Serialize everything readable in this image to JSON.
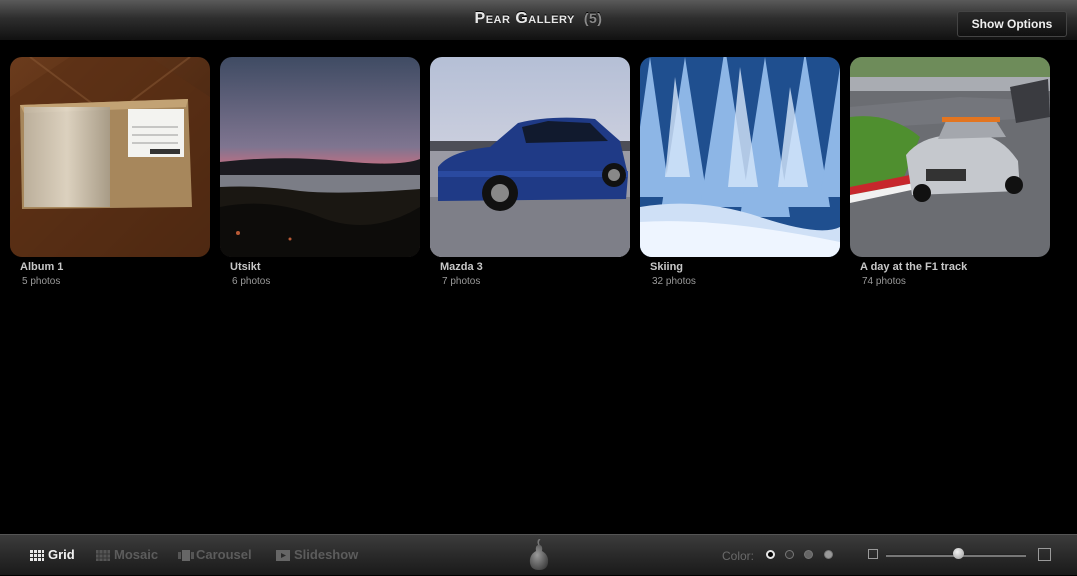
{
  "header": {
    "title": "Pear Gallery",
    "count": "(5)",
    "show_options_label": "Show Options"
  },
  "albums": [
    {
      "name": "Album 1",
      "count": "5 photos",
      "thumb": "cardboard-box-photo"
    },
    {
      "name": "Utsikt",
      "count": "6 photos",
      "thumb": "sunset-lake-photo"
    },
    {
      "name": "Mazda 3",
      "count": "7 photos",
      "thumb": "blue-car-photo"
    },
    {
      "name": "Skiing",
      "count": "32 photos",
      "thumb": "snowy-forest-photo"
    },
    {
      "name": "A day at the F1 track",
      "count": "74 photos",
      "thumb": "race-car-photo"
    }
  ],
  "toolbar": {
    "modes": [
      {
        "label": "Grid",
        "icon": "grid-icon",
        "active": true
      },
      {
        "label": "Mosaic",
        "icon": "mosaic-icon",
        "active": false
      },
      {
        "label": "Carousel",
        "icon": "carousel-icon",
        "active": false
      },
      {
        "label": "Slideshow",
        "icon": "slideshow-icon",
        "active": false
      }
    ],
    "logo": "pear-logo",
    "color_label": "Color:",
    "color_swatches": [
      "#000000",
      "#333333",
      "#666666",
      "#999999"
    ],
    "selected_swatch": 0,
    "size_slider_value": 0.52
  }
}
